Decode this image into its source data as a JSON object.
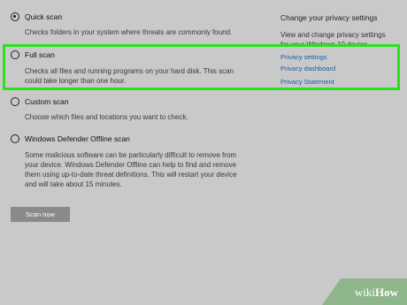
{
  "scan_options": {
    "quick": {
      "label": "Quick scan",
      "description": "Checks folders in your system where threats are commonly found.",
      "selected": true
    },
    "full": {
      "label": "Full scan",
      "description_line1": "Checks all files and running programs on your hard disk. This scan",
      "description_line2": "could take longer than one hour.",
      "selected": false
    },
    "custom": {
      "label": "Custom scan",
      "description": "Choose which files and locations you want to check.",
      "selected": false
    },
    "offline": {
      "label": "Windows Defender Offline scan",
      "description_line1": "Some malicious software can be particularly difficult to remove from",
      "description_line2": "your device. Windows Defender Offline can help to find and remove",
      "description_line3": "them using up-to-date threat definitions. This will restart your device",
      "description_line4": "and will take about 15 minutes.",
      "selected": false
    }
  },
  "scan_now_label": "Scan now",
  "privacy": {
    "heading": "Change your privacy settings",
    "desc_line1": "View and change privacy settings",
    "desc_line2": "for your Windows 10 device.",
    "links": {
      "settings": "Privacy settings",
      "dashboard": "Privacy dashboard",
      "statement": "Privacy Statement"
    }
  },
  "watermark": {
    "wiki": "wiki",
    "how": "How"
  },
  "colors": {
    "background": "#c9c9c9",
    "highlight": "#27e21c",
    "link": "#1d5da8",
    "button": "#8a8a8a"
  }
}
